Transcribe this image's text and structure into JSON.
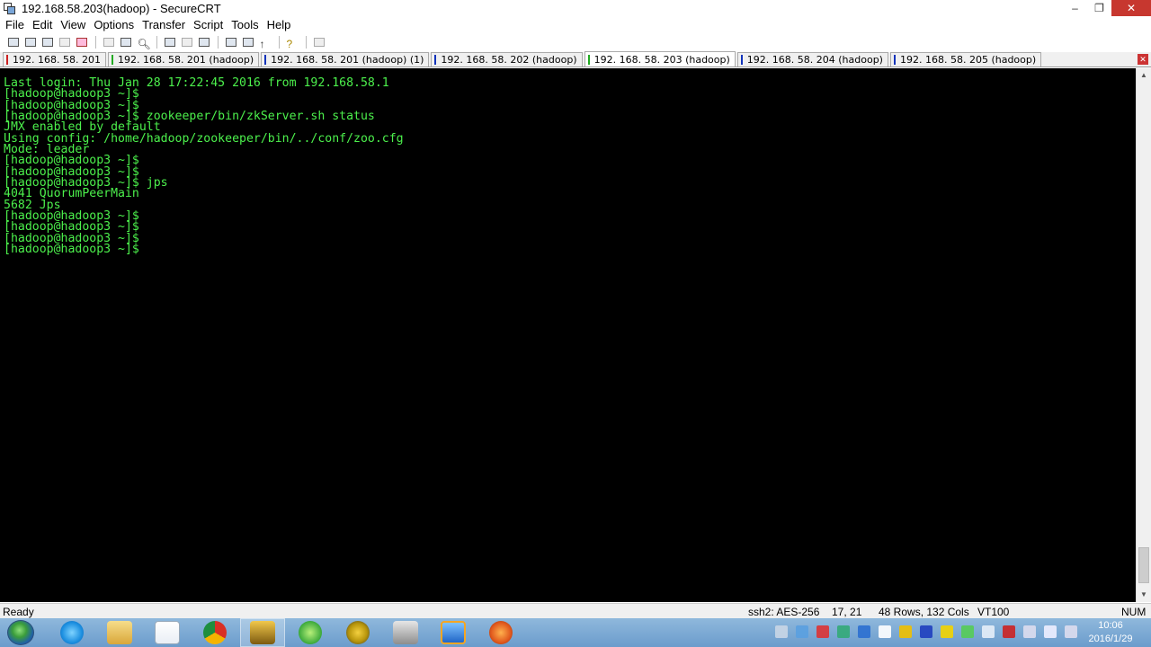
{
  "window": {
    "title": "192.168.58.203(hadoop) - SecureCRT"
  },
  "window_controls": {
    "minimize": "–",
    "restore": "❐",
    "close": "✕"
  },
  "menu": [
    "File",
    "Edit",
    "View",
    "Options",
    "Transfer",
    "Script",
    "Tools",
    "Help"
  ],
  "tabs": [
    {
      "label": "192. 168. 58. 201",
      "color": "#cc2222"
    },
    {
      "label": "192. 168. 58. 201 (hadoop)",
      "color": "#22aa22"
    },
    {
      "label": "192. 168. 58. 201 (hadoop)   (1)",
      "color": "#1133bb"
    },
    {
      "label": "192. 168. 58. 202 (hadoop)",
      "color": "#1133bb"
    },
    {
      "label": "192. 168. 58. 203 (hadoop)",
      "color": "#22aa22",
      "active": true
    },
    {
      "label": "192. 168. 58. 204 (hadoop)",
      "color": "#1133bb"
    },
    {
      "label": "192. 168. 58. 205 (hadoop)",
      "color": "#1133bb"
    }
  ],
  "tab_close": "✕",
  "terminal": {
    "text_color": "#4cf04c",
    "background": "#000000",
    "lines": [
      "Last login: Thu Jan 28 17:22:45 2016 from 192.168.58.1",
      "[hadoop@hadoop3 ~]$",
      "[hadoop@hadoop3 ~]$",
      "[hadoop@hadoop3 ~]$ zookeeper/bin/zkServer.sh status",
      "JMX enabled by default",
      "Using config: /home/hadoop/zookeeper/bin/../conf/zoo.cfg",
      "Mode: leader",
      "[hadoop@hadoop3 ~]$",
      "[hadoop@hadoop3 ~]$",
      "[hadoop@hadoop3 ~]$ jps",
      "4041 QuorumPeerMain",
      "5682 Jps",
      "[hadoop@hadoop3 ~]$",
      "[hadoop@hadoop3 ~]$",
      "[hadoop@hadoop3 ~]$",
      "[hadoop@hadoop3 ~]$"
    ]
  },
  "status": {
    "ready": "Ready",
    "cipher": "ssh2: AES-256",
    "cursor": "17,  21",
    "size": "48 Rows, 132 Cols",
    "emulation": "VT100",
    "num": "NUM"
  },
  "taskbar": {
    "apps": [
      "internet-explorer",
      "file-explorer",
      "media-player",
      "chrome",
      "securecrt",
      "browser-green",
      "app-e",
      "app-generic",
      "remote-desktop",
      "game-icon"
    ],
    "clock_time": "10:06",
    "clock_date": "2016/1/29"
  }
}
